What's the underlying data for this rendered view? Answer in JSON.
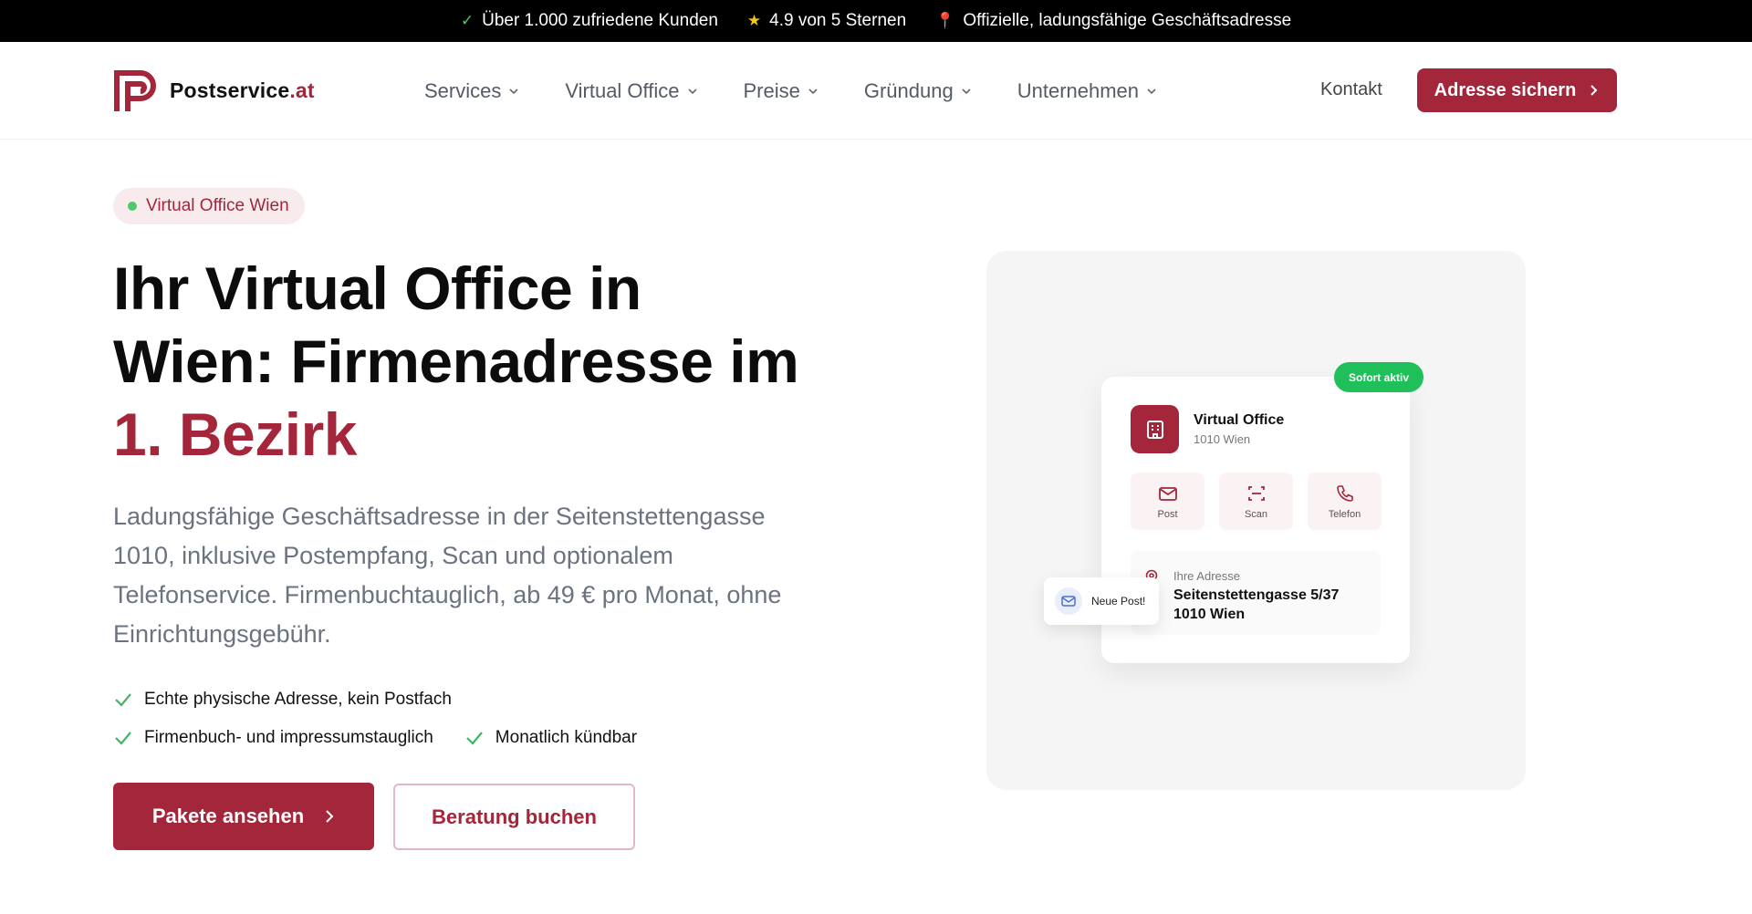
{
  "topbar": {
    "items": [
      {
        "icon": "check-icon",
        "text": "Über 1.000 zufriedene Kunden"
      },
      {
        "icon": "star-icon",
        "text": "4.9 von 5 Sternen"
      },
      {
        "icon": "pin-icon",
        "text": "Offizielle, ladungsfähige Geschäftsadresse"
      }
    ]
  },
  "nav": {
    "logo_name": "Postservice",
    "logo_tld": ".at",
    "menu": [
      "Services",
      "Virtual Office",
      "Preise",
      "Gründung",
      "Unternehmen"
    ],
    "kontakt": "Kontakt",
    "cta": "Adresse sichern"
  },
  "hero": {
    "badge": "Virtual Office Wien",
    "headline_line1": "Ihr Virtual Office in",
    "headline_line2": "Wien: Firmenadresse im",
    "headline_accent": "1. Bezirk",
    "lead": "Ladungsfähige Geschäftsadresse in der Seitenstettengasse 1010, inklusive Postempfang, Scan und optionalem Telefonservice. Firmenbuchtauglich, ab 49 € pro Monat, ohne Einrichtungsgebühr.",
    "features": [
      "Echte physische Adresse, kein Postfach",
      "Firmenbuch- und impressumstauglich",
      "Monatlich kündbar"
    ],
    "btn_primary": "Pakete ansehen",
    "btn_secondary": "Beratung buchen"
  },
  "card": {
    "badge": "Sofort aktiv",
    "title": "Virtual Office",
    "subtitle": "1010 Wien",
    "tiles": [
      "Post",
      "Scan",
      "Telefon"
    ],
    "address_label": "Ihre Adresse",
    "address_line1": "Seitenstettengasse 5/37",
    "address_line2": "1010 Wien",
    "notification": "Neue Post!"
  },
  "colors": {
    "brand": "#a3263a",
    "success": "#1fbf5a",
    "topbar_bg": "#000000"
  }
}
